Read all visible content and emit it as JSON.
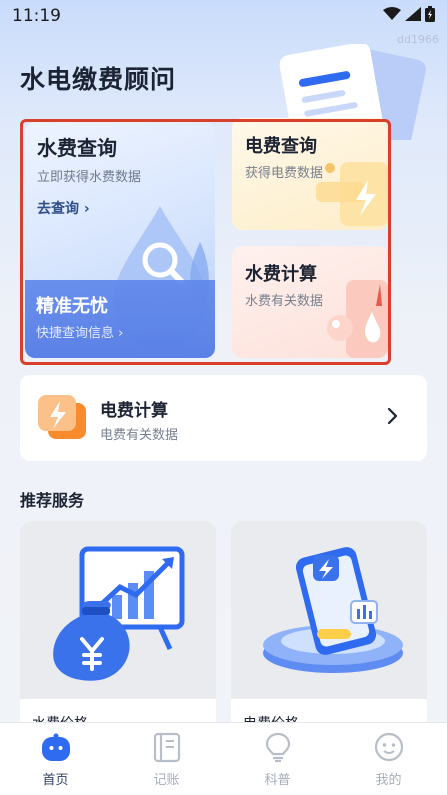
{
  "status_bar": {
    "time": "11:19",
    "watermark": "dd1966"
  },
  "page_title": "水电缴费顾问",
  "cards": {
    "water_query": {
      "title": "水费查询",
      "subtitle": "立即获得水费数据",
      "link": "去查询 ›",
      "band_title": "精准无忧",
      "band_subtitle": "快捷查询信息 ›"
    },
    "elec_query": {
      "title": "电费查询",
      "subtitle": "获得电费数据"
    },
    "water_calc": {
      "title": "水费计算",
      "subtitle": "水费有关数据"
    },
    "elec_calc": {
      "title": "电费计算",
      "subtitle": "电费有关数据",
      "chevron": "›"
    }
  },
  "section": {
    "title": "推荐服务"
  },
  "services": [
    {
      "label": "水费价格",
      "icon": "money-bag-chart-icon"
    },
    {
      "label": "电费价格",
      "icon": "phone-lightning-icon"
    }
  ],
  "tabs": [
    {
      "label": "首页",
      "icon": "home-robot-icon",
      "active": true
    },
    {
      "label": "记账",
      "icon": "notebook-icon",
      "active": false
    },
    {
      "label": "科普",
      "icon": "lightbulb-icon",
      "active": false
    },
    {
      "label": "我的",
      "icon": "profile-face-icon",
      "active": false
    }
  ],
  "colors": {
    "accent": "#2f6bf0",
    "highlight_frame": "#d9402c",
    "text_primary": "#1c2433",
    "tab_inactive": "#a6adb8"
  }
}
